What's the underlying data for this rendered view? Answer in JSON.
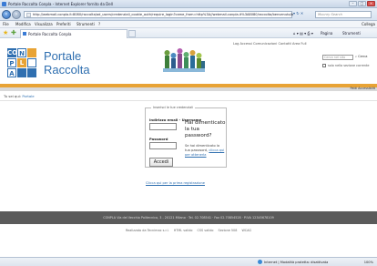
{
  "browser": {
    "window_title": "Portale Raccolta Conpla - Internet Explorer fornito da Dell",
    "url": "http://webmail.conpla.it:8080/raccolta/ad_users/credenziali_cookie_auth/require_login?came_from=http%3A//webmail.conpla.it%3A8080/raccolta/benvenuto/b",
    "search_placeholder": "Moonry Search",
    "menu": [
      "File",
      "Modifica",
      "Visualizza",
      "Preferiti",
      "Strumenti",
      "?"
    ],
    "menu_right": "Collega",
    "tab_label": "Portale Raccolta Conpla",
    "commands": {
      "pagina": "Pagina",
      "strumenti": "Strumenti"
    },
    "status_text": "Internet | Modalità protetta: disattivata",
    "zoom": "100%"
  },
  "header": {
    "logo_letters": [
      "CO",
      "N",
      "P",
      "L",
      "A"
    ],
    "brand_line1": "Portale",
    "brand_line2": "Raccolta",
    "top_links": "Log Accessi  Comunicazioni  Contatti  Area Full",
    "search_placeholder": "Cerca nel sito",
    "search_button": "Cerca",
    "only_section_label": "solo nella sezione corrente",
    "utility": "Patti Accessibilit"
  },
  "breadcrumb": {
    "prefix": "Tu sei qui:",
    "current": "Portale"
  },
  "login": {
    "legend": "Inserisci le tue credenziali",
    "email_label": "Indirizzo email - Username",
    "password_label": "Password",
    "submit_label": "Accedi",
    "forgot_title": "Hai dimenticato la tua password?",
    "forgot_text": "Se hai dimenticato la tua password,",
    "forgot_link": "clicca qui per ottenerla",
    "register_link": "Clicca qui per la prima registrazione"
  },
  "footer": {
    "address": "CONPLA Via del Vecchio Politecnico, 3 - 20121 Milano · Tel. 02.708541 · Fax 02.70854528 · P.IVA 12345678109",
    "credits": [
      "Realizzato da Tecnimax s.r.l.",
      "HTML valido",
      "CSS valido",
      "Sezione 508",
      "WCAG"
    ]
  },
  "colors": {
    "brand_blue": "#2f6fb0",
    "accent_orange": "#e8a335",
    "footer_gray": "#5b5b5b",
    "logo_blue": "#2f6fb0",
    "logo_orange": "#e8a335"
  }
}
